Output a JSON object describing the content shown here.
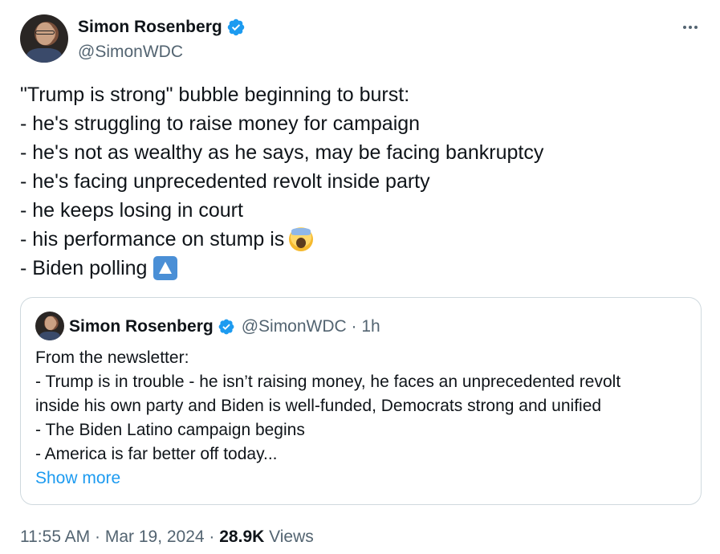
{
  "author": {
    "name": "Simon Rosenberg",
    "handle": "@SimonWDC"
  },
  "tweet": {
    "lines": [
      "\"Trump is strong\" bubble beginning to burst:",
      "- he's struggling to raise money for campaign",
      "- he's not as wealthy as he says, may be facing bankruptcy",
      "- he's facing unprecedented revolt inside party",
      "- he keeps losing in court",
      "- his performance on stump is",
      "- Biden polling"
    ],
    "emojis": [
      "screaming-face-emoji",
      "up-button-emoji"
    ]
  },
  "quote": {
    "name": "Simon Rosenberg",
    "handle_time": "@SimonWDC · 1h",
    "lines": [
      "From the newsletter:",
      "- Trump is in trouble - he isn’t raising money, he faces an unprecedented revolt",
      "inside his own party and Biden is well-funded, Democrats strong and unified",
      "- The Biden Latino campaign begins",
      "- America is far better off today..."
    ],
    "show_more": "Show more"
  },
  "footer": {
    "timestamp": "11:55 AM · Mar 19, 2024",
    "separator": " · ",
    "views_count": "28.9K",
    "views_label": " Views"
  },
  "colors": {
    "accent": "#1d9bf0",
    "muted": "#536471",
    "text": "#0f1419",
    "border": "#cfd9de"
  },
  "icons": [
    "verified-badge-icon",
    "more-options-icon"
  ]
}
